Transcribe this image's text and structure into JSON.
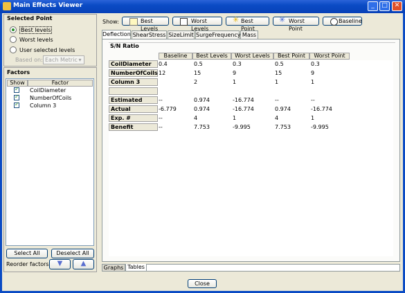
{
  "window": {
    "title": "Main Effects Viewer",
    "min": "_",
    "max": "□",
    "close": "✕"
  },
  "selected_point": {
    "heading": "Selected Point",
    "options": [
      "Best levels",
      "Worst levels",
      "User selected levels"
    ],
    "selected": "Best levels",
    "based_on_label": "Based on:",
    "based_on_value": "Each Metric"
  },
  "factors": {
    "heading": "Factors",
    "col_show": "Show",
    "col_factor": "Factor",
    "items": [
      "CoilDiameter",
      "NumberOfCoils",
      "Column 3"
    ],
    "select_all": "Select All",
    "deselect_all": "Deselect All",
    "reorder_label": "Reorder factors:"
  },
  "show_bar": {
    "label": "Show:",
    "buttons": [
      "Best Levels",
      "Worst Levels",
      "Best Point",
      "Worst Point",
      "Baseline"
    ]
  },
  "tabs": [
    "Deflection",
    "ShearStress",
    "SizeLimit",
    "SurgeFrequency",
    "Mass"
  ],
  "active_tab": "Deflection",
  "table": {
    "title": "S/N Ratio",
    "columns": [
      "Baseline",
      "Best Levels",
      "Worst Levels",
      "Best Point",
      "Worst Point"
    ],
    "rows": [
      {
        "label": "CoilDiameter",
        "cells": [
          "0.4",
          "0.5",
          "0.3",
          "0.5",
          "0.3"
        ]
      },
      {
        "label": "NumberOfCoils",
        "cells": [
          "12",
          "15",
          "9",
          "15",
          "9"
        ]
      },
      {
        "label": "Column 3",
        "cells": [
          "",
          "2",
          "1",
          "1",
          "1"
        ]
      },
      {
        "label": "",
        "cells": [
          "",
          "",
          "",
          "",
          ""
        ]
      },
      {
        "label": "Estimated",
        "cells": [
          "--",
          "0.974",
          "-16.774",
          "--",
          "--"
        ]
      },
      {
        "label": "Actual",
        "cells": [
          "-6.779",
          "0.974",
          "-16.774",
          "0.974",
          "-16.774"
        ]
      },
      {
        "label": "Exp. #",
        "cells": [
          "--",
          "4",
          "1",
          "4",
          "1"
        ]
      },
      {
        "label": "Benefit",
        "cells": [
          "--",
          "7.753",
          "-9.995",
          "7.753",
          "-9.995"
        ]
      }
    ]
  },
  "bottom_tabs": [
    "Graphs",
    "Tables"
  ],
  "active_bottom_tab": "Tables",
  "close_button": "Close"
}
